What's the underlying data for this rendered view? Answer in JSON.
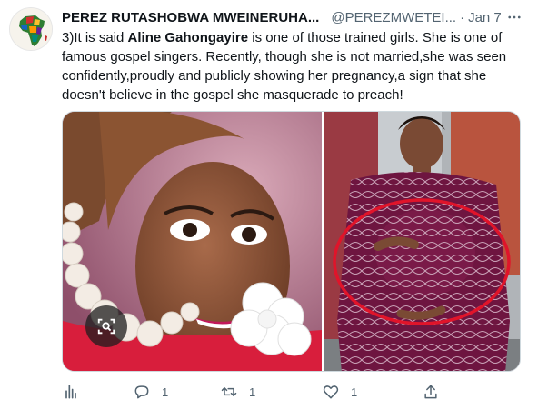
{
  "tweet": {
    "author_name": "PEREZ RUTASHOBWA MWEINERUHA...",
    "handle": "@PEREZMWETEI...",
    "separator": "·",
    "date": "Jan 7",
    "text_before": "3)It is said ",
    "text_bold": "Aline Gahongayire",
    "text_after": " is one of those trained girls. She is one of famous gospel singers. Recently, though she is not married,she was seen confidently,proudly and publicly showing her pregnancy,a sign that she doesn't  believe in the gospel she masquerade to preach!"
  },
  "actions": {
    "analytics_icon": "analytics-icon",
    "reply_count": "1",
    "retweet_count": "1",
    "like_count": "1",
    "share_icon": "share-icon"
  },
  "colors": {
    "text": "#0f1419",
    "secondary": "#536471",
    "border": "#cfd9de",
    "highlight_circle": "#e0142a"
  }
}
